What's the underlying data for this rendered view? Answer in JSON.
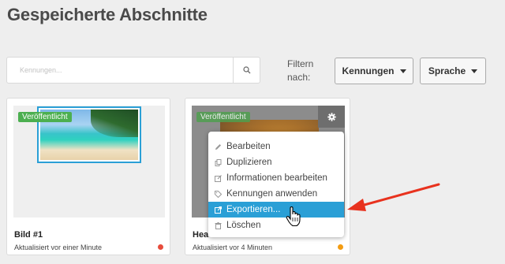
{
  "page": {
    "title": "Gespeicherte Abschnitte"
  },
  "search": {
    "placeholder": "Kennungen...",
    "icon": "search-icon"
  },
  "filters": {
    "label": "Filtern nach:",
    "tags_dropdown": "Kennungen",
    "language_dropdown": "Sprache"
  },
  "cards": [
    {
      "badge": "Veröffentlicht",
      "title": "Bild #1",
      "updated": "Aktualisiert vor einer Minute",
      "status_color": "#e74c3c"
    },
    {
      "badge": "Veröffentlicht",
      "title": "Hea",
      "updated": "Aktualisiert vor 4 Minuten",
      "status_color": "#f39c12"
    }
  ],
  "context_menu": {
    "items": [
      {
        "label": "Bearbeiten",
        "icon": "pencil-icon"
      },
      {
        "label": "Duplizieren",
        "icon": "copy-icon"
      },
      {
        "label": "Informationen bearbeiten",
        "icon": "edit-info-icon"
      },
      {
        "label": "Kennungen anwenden",
        "icon": "tag-icon"
      },
      {
        "label": "Exportieren...",
        "icon": "export-icon",
        "active": true
      },
      {
        "label": "Löschen",
        "icon": "trash-icon"
      }
    ]
  },
  "colors": {
    "accent": "#2a9fd6",
    "published_badge": "#4caf50",
    "annotation_arrow": "#e8321e"
  }
}
